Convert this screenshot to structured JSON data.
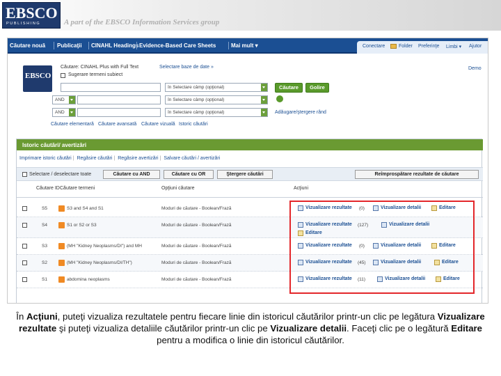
{
  "banner": {
    "logo_text": "EBSCO",
    "logo_sub": "PUBLISHING",
    "tagline": "A part of the EBSCO Information Services group"
  },
  "navbar": {
    "items": [
      "Căutare nouă",
      "Publicaţii",
      "CINAHL Headings",
      "Evidence-Based Care Sheets",
      "Mai mult ▾"
    ],
    "right": [
      "Conectare",
      "Folder",
      "Preferinţe",
      "Limbi ▾",
      "Ajutor"
    ]
  },
  "search": {
    "db_logo": "EBSCO",
    "searching_label": "Căutare: CINAHL Plus with Full Text",
    "choose_db": "Selectare baze de date »",
    "suggest_label": "Sugerare termeni subiect",
    "demo": "Demo",
    "field_placeholder": "în  Selectare câmp (opţional)",
    "bool1": "AND",
    "bool2": "AND",
    "search_btn": "Căutare",
    "clear_btn": "Golire",
    "add_remove": "Adăugare/ştergere rând",
    "links": [
      "Căutare elementară",
      "Căutare avansată",
      "Căutare vizuală",
      "Istoric căutări"
    ]
  },
  "history": {
    "title": "Istoric căutări/ avertizări",
    "links": [
      "Imprimare istoric căutări",
      "Regăsire căutări",
      "Regăsire avertizări",
      "Salvare căutări / avertizări"
    ],
    "select_all": "Selectare / deselectare toate",
    "btn_and": "Căutare cu AND",
    "btn_or": "Căutare cu OR",
    "btn_delete": "Ştergere căutări",
    "btn_refresh": "Reîmprospătare rezultate de căutare",
    "col_id": "Căutare ID",
    "col_terms": "Căutare termeni",
    "col_options": "Opţiuni căutare",
    "col_actions": "Acţiuni",
    "rows": [
      {
        "id": "S5",
        "terms": "S3 and S4 and S1",
        "options": "Moduri de căutare - Boolean/Frază",
        "count": "(0)",
        "actions": [
          "Vizualizare rezultate",
          "Vizualizare detalii",
          "Editare"
        ]
      },
      {
        "id": "S4",
        "terms": "S1 or S2 or S3",
        "options": "Moduri de căutare - Boolean/Frază",
        "count": "(127)",
        "actions": [
          "Vizualizare rezultate",
          "Vizualizare detalii",
          "Editare"
        ]
      },
      {
        "id": "S3",
        "terms": "(MH \"Kidney Neoplasms/DI\") and MH",
        "options": "Moduri de căutare - Boolean/Frază",
        "count": "(0)",
        "actions": [
          "Vizualizare rezultate",
          "Vizualizare detalii",
          "Editare"
        ]
      },
      {
        "id": "S2",
        "terms": "(MH \"Kidney Neoplasms/DI/TH\")",
        "options": "Moduri de căutare - Boolean/Frază",
        "count": "(45)",
        "actions": [
          "Vizualizare rezultate",
          "Vizualizare detalii",
          "Editare"
        ]
      },
      {
        "id": "S1",
        "terms": "abdomina neoplasms",
        "options": "Moduri de căutare - Boolean/Frază",
        "count": "(11)",
        "actions": [
          "Vizualizare rezultate",
          "Vizualizare detalii",
          "Editare"
        ]
      }
    ]
  },
  "caption": {
    "p1": "În ",
    "b1": "Acţiuni",
    "p2": ", puteţi vizualiza rezultatele pentru fiecare linie din istoricul căutărilor printr-un clic pe legătura ",
    "b2": "Vizualizare rezultate",
    "p3": " şi puteţi vizualiza detaliile căutărilor printr-un clic pe ",
    "b3": "Vizualizare detalii",
    "p4": ". Faceţi clic pe o legătură ",
    "b4": "Editare",
    "p5": " pentru a modifica o linie din istoricul căutărilor."
  },
  "colors": {
    "nav": "#1b4f93",
    "green": "#6a9a32",
    "highlight": "#e3262a"
  }
}
